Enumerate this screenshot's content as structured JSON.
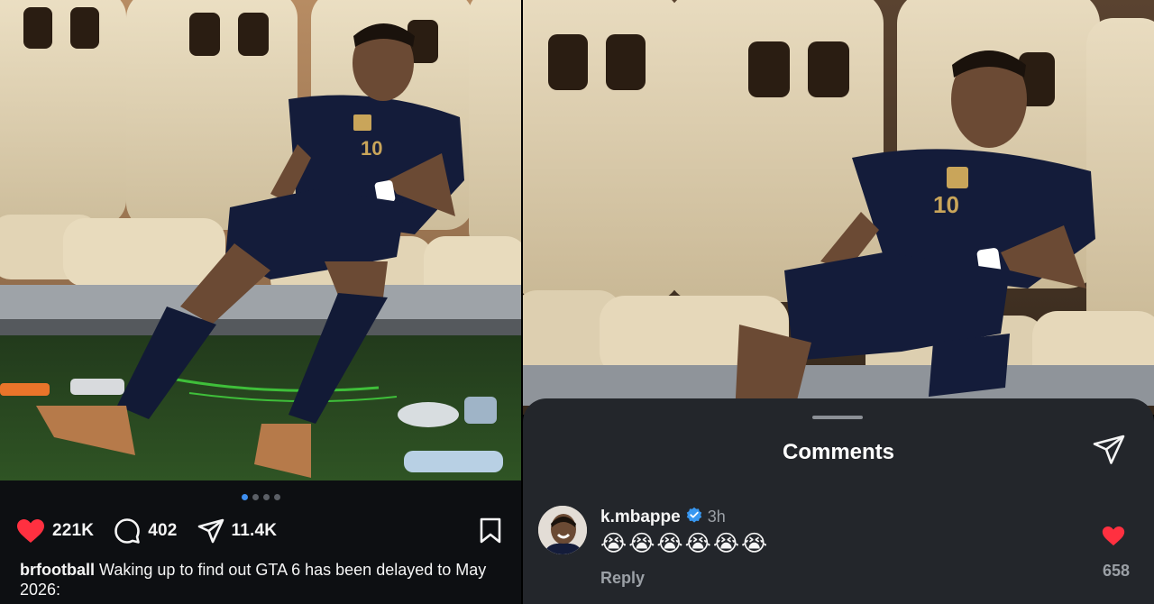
{
  "post": {
    "like_count": "221K",
    "comment_count": "402",
    "share_count": "11.4K",
    "carousel_total": 4,
    "carousel_active": 1,
    "caption_user": "brfootball",
    "caption_text": " Waking up to find out GTA 6 has been delayed to May 2026:"
  },
  "comments_sheet": {
    "title": "Comments",
    "comment": {
      "username": "k.mbappe",
      "verified": true,
      "time": "3h",
      "text": "😭😭😭😭😭😭",
      "reply_label": "Reply",
      "like_count": "658"
    }
  },
  "colors": {
    "like_red": "#ff3040",
    "verified_blue": "#3897f0",
    "active_dot": "#3e8ff0",
    "sheet_bg": "#23262b"
  },
  "icons": [
    "heart-icon",
    "comment-icon",
    "share-icon",
    "bookmark-icon",
    "verified-icon",
    "send-icon"
  ]
}
